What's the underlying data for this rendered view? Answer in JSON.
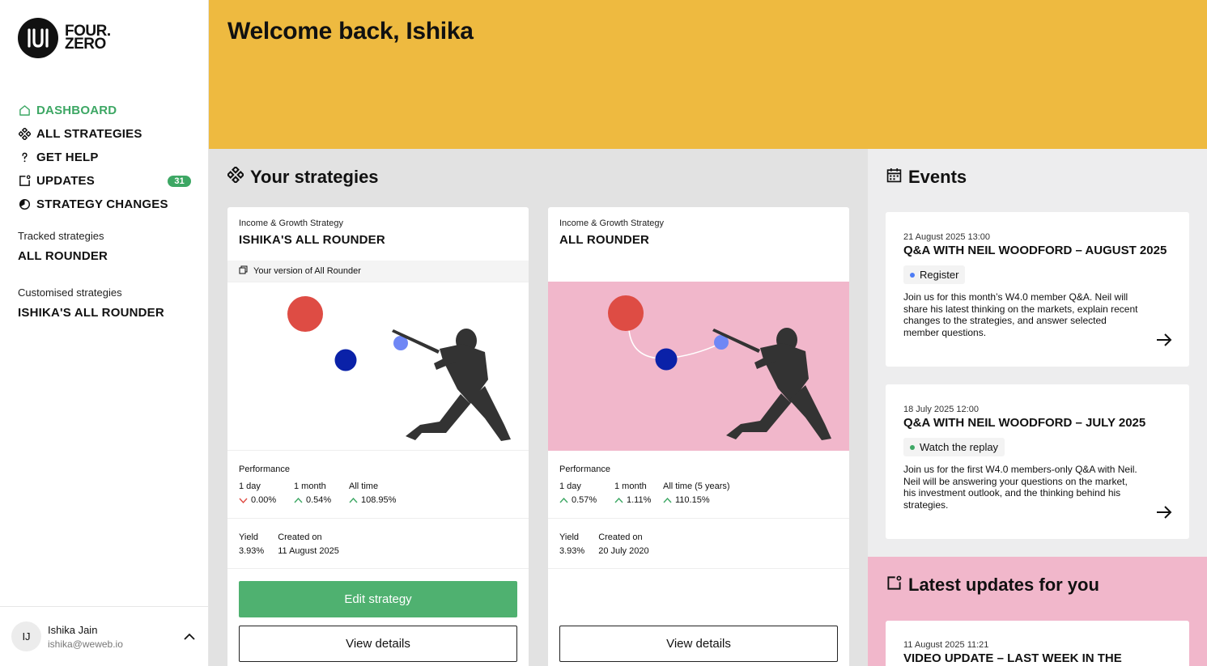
{
  "brand": {
    "line1": "FOUR.",
    "line2": "ZERO"
  },
  "nav": {
    "items": [
      {
        "label": "DASHBOARD",
        "icon": "home-icon",
        "active": true
      },
      {
        "label": "ALL STRATEGIES",
        "icon": "strategies-icon"
      },
      {
        "label": "GET HELP",
        "icon": "question-icon"
      },
      {
        "label": "UPDATES",
        "icon": "updates-icon",
        "badge": "31"
      },
      {
        "label": "STRATEGY CHANGES",
        "icon": "strategy-changes-icon"
      }
    ]
  },
  "tracked": {
    "label": "Tracked strategies",
    "items": [
      "ALL ROUNDER"
    ]
  },
  "customised": {
    "label": "Customised strategies",
    "items": [
      "ISHIKA'S ALL ROUNDER"
    ]
  },
  "user": {
    "initials": "IJ",
    "name": "Ishika Jain",
    "email": "ishika@weweb.io"
  },
  "banner": {
    "title": "Welcome back, Ishika"
  },
  "strategies": {
    "title": "Your strategies",
    "cards": [
      {
        "category": "Income & Growth Strategy",
        "name": "ISHIKA'S ALL ROUNDER",
        "version_note": "Your version of All Rounder",
        "performance_title": "Performance",
        "perf": [
          {
            "label": "1 day",
            "value": "0.00%",
            "trend": "down"
          },
          {
            "label": "1 month",
            "value": "0.54%",
            "trend": "up"
          },
          {
            "label": "All time",
            "value": "108.95%",
            "trend": "up"
          }
        ],
        "yield_label": "Yield",
        "yield": "3.93%",
        "created_label": "Created on",
        "created": "11 August 2025",
        "edit_label": "Edit strategy",
        "view_label": "View details"
      },
      {
        "category": "Income & Growth Strategy",
        "name": "ALL ROUNDER",
        "performance_title": "Performance",
        "perf": [
          {
            "label": "1 day",
            "value": "0.57%",
            "trend": "up"
          },
          {
            "label": "1 month",
            "value": "1.11%",
            "trend": "up"
          },
          {
            "label": "All time (5 years)",
            "value": "110.15%",
            "trend": "up"
          }
        ],
        "yield_label": "Yield",
        "yield": "3.93%",
        "created_label": "Created on",
        "created": "20 July 2020",
        "view_label": "View details"
      }
    ]
  },
  "events": {
    "title": "Events",
    "items": [
      {
        "date": "21 August 2025 13:00",
        "title": "Q&A WITH NEIL WOODFORD – AUGUST 2025",
        "action": "Register",
        "action_color": "#4d7cf5",
        "desc": "Join us for this month’s W4.0 member Q&A. Neil will share his latest thinking on the markets, explain recent changes to the strategies, and answer selected member questions."
      },
      {
        "date": "18 July 2025 12:00",
        "title": "Q&A WITH NEIL WOODFORD – JULY 2025",
        "action": "Watch the replay",
        "action_color": "#3da764",
        "desc": "Join us for the first W4.0 members-only Q&A with Neil. Neil will be answering your questions on the market, his investment outlook, and the thinking behind his strategies."
      }
    ]
  },
  "updates": {
    "title": "Latest updates for you",
    "items": [
      {
        "date": "11 August 2025 11:21",
        "title": "VIDEO UPDATE – LAST WEEK IN THE"
      }
    ]
  },
  "colors": {
    "accent_green": "#3da764",
    "banner_yellow": "#eeba40",
    "pink": "#f1b7cb",
    "red_dot": "#de4c44",
    "navy_dot": "#0a21a8",
    "blue_dot": "#6f87f5"
  }
}
